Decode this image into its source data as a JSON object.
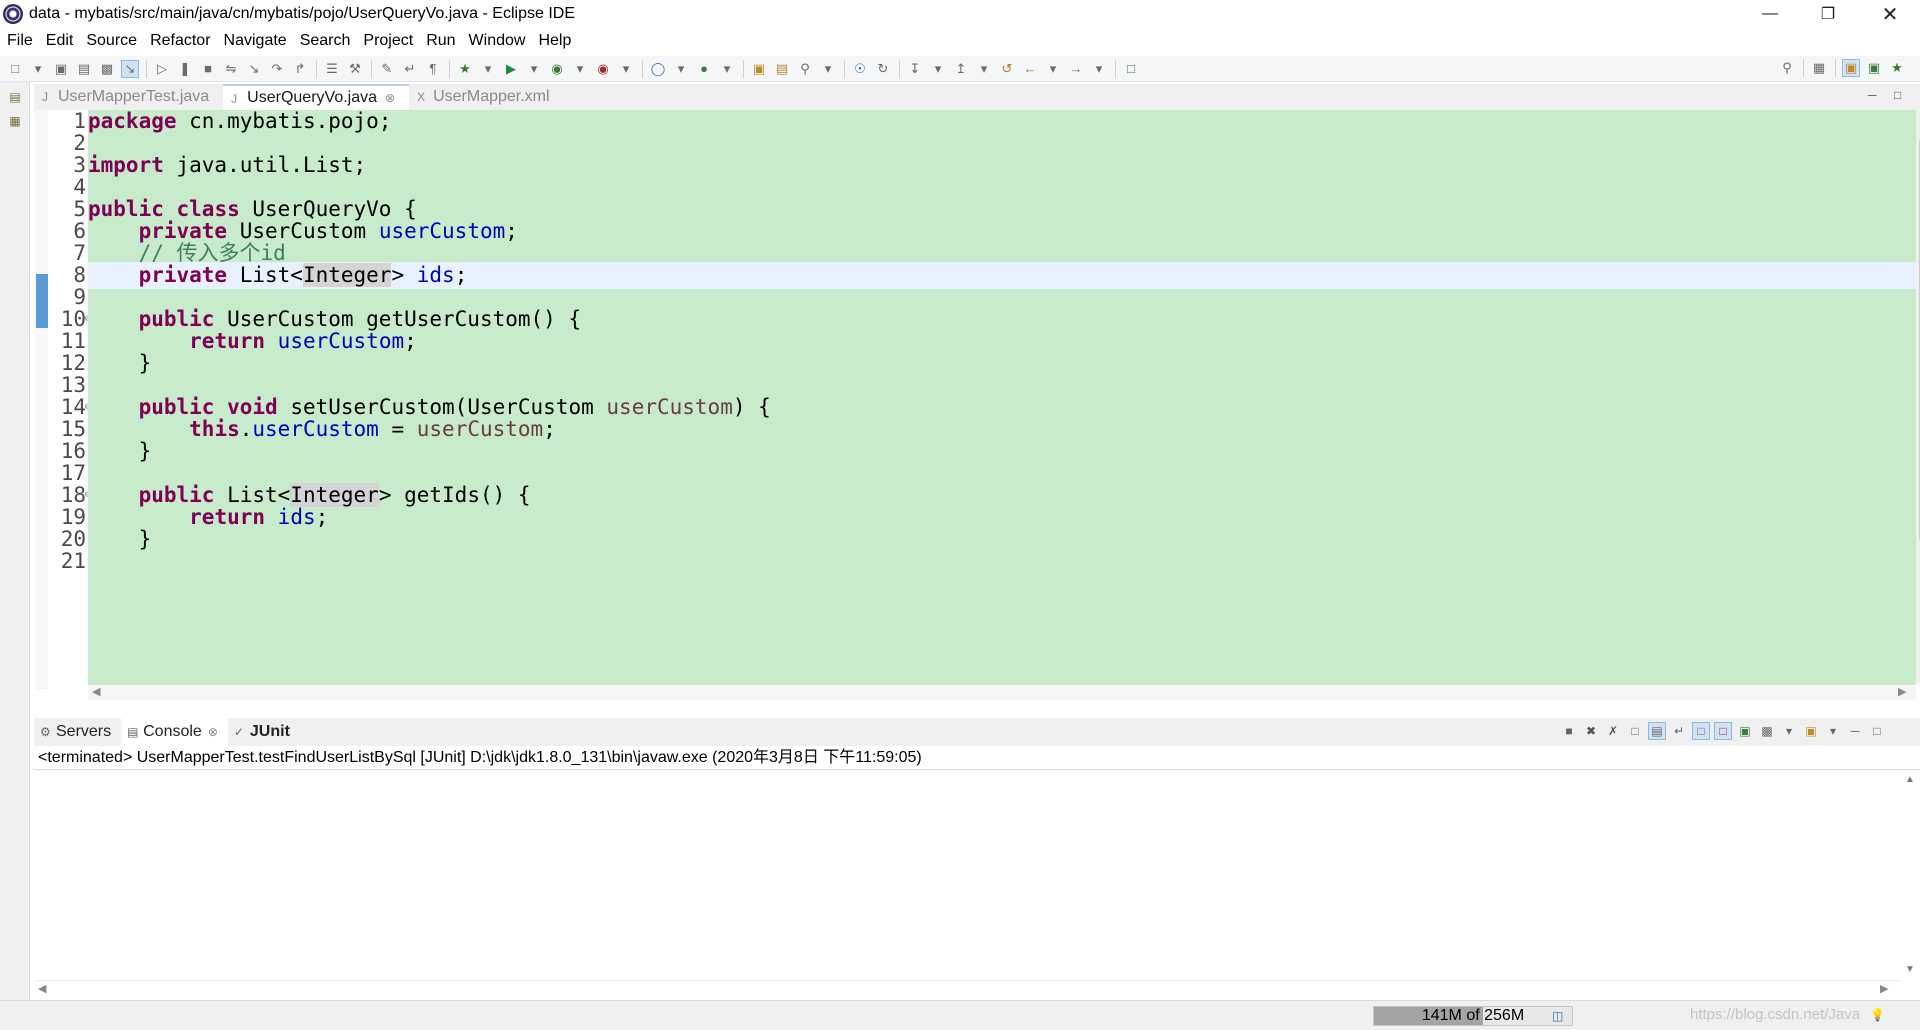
{
  "window": {
    "title": "data - mybatis/src/main/java/cn/mybatis/pojo/UserQueryVo.java - Eclipse IDE",
    "app_icon": "eclipse-icon",
    "controls": [
      "minimize",
      "restore",
      "close"
    ]
  },
  "menubar": {
    "items": [
      "File",
      "Edit",
      "Source",
      "Refactor",
      "Navigate",
      "Search",
      "Project",
      "Run",
      "Window",
      "Help"
    ]
  },
  "editor": {
    "tabs": [
      {
        "label": "UserMapperTest.java",
        "icon": "java-file-icon",
        "active": false
      },
      {
        "label": "UserQueryVo.java",
        "icon": "java-file-icon",
        "active": true
      },
      {
        "label": "UserMapper.xml",
        "icon": "xml-file-icon",
        "active": false
      }
    ],
    "current_line": 8,
    "lines": [
      {
        "n": "1",
        "text": "package cn.mybatis.pojo;"
      },
      {
        "n": "2",
        "text": ""
      },
      {
        "n": "3",
        "text": "import java.util.List;"
      },
      {
        "n": "4",
        "text": ""
      },
      {
        "n": "5",
        "text": "public class UserQueryVo {"
      },
      {
        "n": "6",
        "text": "    private UserCustom userCustom;"
      },
      {
        "n": "7",
        "text": "    // 传入多个id"
      },
      {
        "n": "8",
        "text": "    private List<Integer> ids;"
      },
      {
        "n": "9",
        "text": ""
      },
      {
        "n": "10",
        "text": "    public UserCustom getUserCustom() {"
      },
      {
        "n": "11",
        "text": "        return userCustom;"
      },
      {
        "n": "12",
        "text": "    }"
      },
      {
        "n": "13",
        "text": ""
      },
      {
        "n": "14",
        "text": "    public void setUserCustom(UserCustom userCustom) {"
      },
      {
        "n": "15",
        "text": "        this.userCustom = userCustom;"
      },
      {
        "n": "16",
        "text": "    }"
      },
      {
        "n": "17",
        "text": ""
      },
      {
        "n": "18",
        "text": "    public List<Integer> getIds() {"
      },
      {
        "n": "19",
        "text": "        return ids;"
      },
      {
        "n": "20",
        "text": "    }"
      },
      {
        "n": "21",
        "text": ""
      }
    ],
    "colors": {
      "background": "#c8ebcc",
      "current_line": "#e8f2fe",
      "keyword": "#7f0055",
      "field": "#0000c0",
      "parameter": "#6a3e3e",
      "comment": "#3f7f5f"
    }
  },
  "bottom_panel": {
    "tabs": [
      {
        "label": "Servers",
        "icon": "servers-icon",
        "active": false
      },
      {
        "label": "Console",
        "icon": "console-icon",
        "active": true
      },
      {
        "label": "JUnit",
        "icon": "junit-icon",
        "active": false
      }
    ],
    "console_header": "<terminated> UserMapperTest.testFindUserListBySql [JUnit] D:\\jdk\\jdk1.8.0_131\\bin\\javaw.exe (2020年3月8日 下午11:59:05)"
  },
  "statusbar": {
    "heap_text": "141M of 256M",
    "heap_used_fraction": 0.55,
    "watermark": "https://blog.csdn.net/Java"
  }
}
